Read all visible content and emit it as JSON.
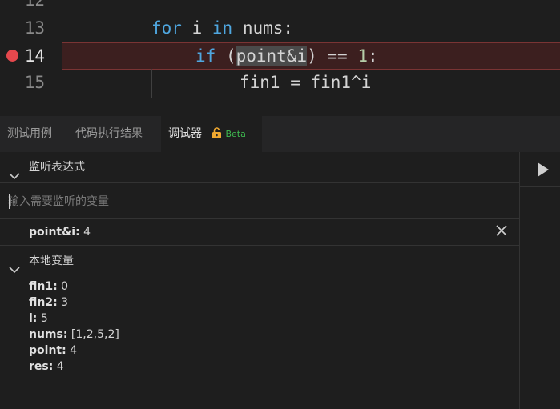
{
  "editor": {
    "lines": [
      {
        "number": "12"
      },
      {
        "number": "13",
        "kw1": "for",
        "var": " i ",
        "kw2": "in",
        "rest": " nums:"
      },
      {
        "number": "14",
        "kw1": "if",
        "open": " (",
        "sel": "point&i",
        "mid": ") == ",
        "num": "1",
        "end": ":"
      },
      {
        "number": "15",
        "text": "fin1 = fin1^i"
      }
    ],
    "breakpoint_color": "#e5484d"
  },
  "tabs": [
    {
      "label": "测试用例"
    },
    {
      "label": "代码执行结果"
    },
    {
      "label": "调试器",
      "badge": "Beta"
    }
  ],
  "watch": {
    "title": "监听表达式",
    "placeholder": "输入需要监听的变量",
    "items": [
      {
        "name": "point&i:",
        "value": "4"
      }
    ]
  },
  "locals": {
    "title": "本地变量",
    "items": [
      {
        "name": "fin1:",
        "value": "0"
      },
      {
        "name": "fin2:",
        "value": "3"
      },
      {
        "name": "i:",
        "value": "5"
      },
      {
        "name": "nums:",
        "value": "[1,2,5,2]"
      },
      {
        "name": "point:",
        "value": "4"
      },
      {
        "name": "res:",
        "value": "4"
      }
    ]
  },
  "icons": {
    "run": "play-icon",
    "close": "close-icon",
    "collapse": "chevron-down-icon",
    "lock": "unlock-icon"
  }
}
